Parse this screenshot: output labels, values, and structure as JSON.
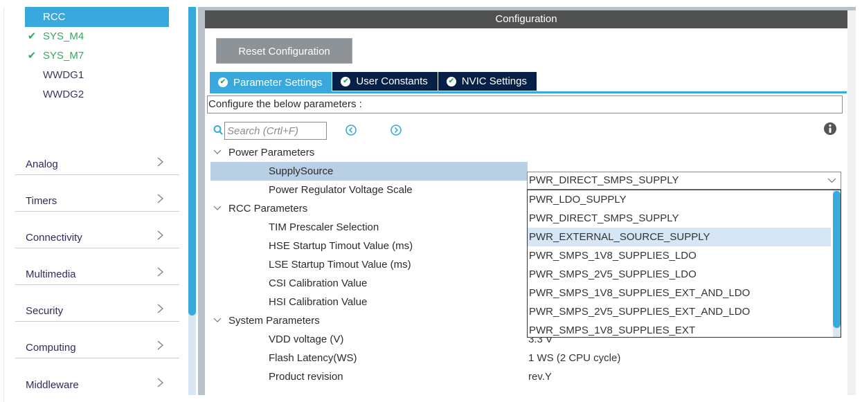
{
  "sidebar": {
    "peripherals": [
      {
        "label": "RCC",
        "state": "selected"
      },
      {
        "label": "SYS_M4",
        "state": "ok"
      },
      {
        "label": "SYS_M7",
        "state": "ok"
      },
      {
        "label": "WWDG1",
        "state": "none"
      },
      {
        "label": "WWDG2",
        "state": "none"
      }
    ],
    "categories": [
      {
        "label": "Analog"
      },
      {
        "label": "Timers"
      },
      {
        "label": "Connectivity"
      },
      {
        "label": "Multimedia"
      },
      {
        "label": "Security"
      },
      {
        "label": "Computing"
      },
      {
        "label": "Middleware"
      }
    ]
  },
  "panel": {
    "title": "Configuration",
    "reset_label": "Reset Configuration",
    "tabs": [
      {
        "label": "Parameter Settings",
        "active": true
      },
      {
        "label": "User Constants",
        "active": false
      },
      {
        "label": "NVIC Settings",
        "active": false
      }
    ],
    "description": "Configure the below parameters :",
    "search": {
      "placeholder": "Search (Crtl+F)",
      "value": ""
    }
  },
  "tree": {
    "groups": [
      {
        "label": "Power Parameters",
        "params": [
          {
            "label": "SupplySource",
            "value": "PWR_DIRECT_SMPS_SUPPLY"
          },
          {
            "label": "Power Regulator Voltage Scale",
            "value": ""
          }
        ]
      },
      {
        "label": "RCC Parameters",
        "params": [
          {
            "label": "TIM Prescaler Selection",
            "value": ""
          },
          {
            "label": "HSE Startup Timout Value (ms)",
            "value": ""
          },
          {
            "label": "LSE Startup Timout Value (ms)",
            "value": ""
          },
          {
            "label": "CSI Calibration Value",
            "value": ""
          },
          {
            "label": "HSI Calibration Value",
            "value": ""
          }
        ]
      },
      {
        "label": "System Parameters",
        "params": [
          {
            "label": "VDD voltage (V)",
            "value": "3.3 V"
          },
          {
            "label": "Flash Latency(WS)",
            "value": "1 WS (2 CPU cycle)"
          },
          {
            "label": "Product revision",
            "value": "rev.Y"
          }
        ]
      }
    ]
  },
  "supply_combo": {
    "selected": "PWR_DIRECT_SMPS_SUPPLY",
    "hovered": "PWR_EXTERNAL_SOURCE_SUPPLY",
    "options": [
      "PWR_LDO_SUPPLY",
      "PWR_DIRECT_SMPS_SUPPLY",
      "PWR_EXTERNAL_SOURCE_SUPPLY",
      "PWR_SMPS_1V8_SUPPLIES_LDO",
      "PWR_SMPS_2V5_SUPPLIES_LDO",
      "PWR_SMPS_1V8_SUPPLIES_EXT_AND_LDO",
      "PWR_SMPS_2V5_SUPPLIES_EXT_AND_LDO",
      "PWR_SMPS_1V8_SUPPLIES_EXT"
    ]
  },
  "colors": {
    "accent": "#39a8dc",
    "tab_inactive": "#062048",
    "header": "#505252",
    "ok_green": "#3aa565",
    "row_highlight": "#b8cfe4",
    "option_hover": "#d7e6f4"
  }
}
